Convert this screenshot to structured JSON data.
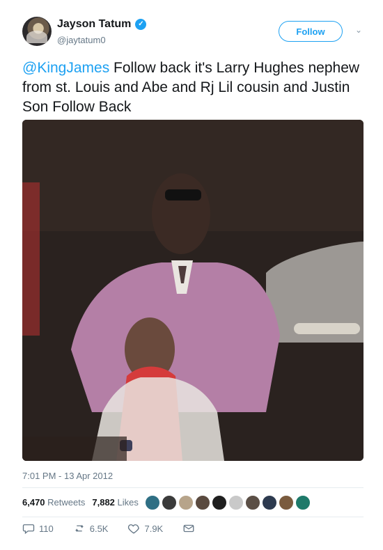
{
  "user": {
    "name": "Jayson Tatum",
    "handle": "@jaytatum0"
  },
  "follow_label": "Follow",
  "tweet": {
    "mention": "@KingJames",
    "text": " Follow back it's Larry Hughes nephew from st. Louis and Abe and Rj Lil cousin and Justin Son Follow Back"
  },
  "timestamp": "7:01 PM - 13 Apr 2012",
  "stats": {
    "retweets_count": "6,470",
    "retweets_label": "Retweets",
    "likes_count": "7,882",
    "likes_label": "Likes"
  },
  "actions": {
    "replies": "110",
    "retweets": "6.5K",
    "likes": "7.9K"
  },
  "likers_colors": [
    "#2f6f84",
    "#3b3b3b",
    "#b7a48a",
    "#5a4a3f",
    "#1f1f1f",
    "#c9c9c9",
    "#5b4f46",
    "#2d3a4f",
    "#7a5b3e",
    "#1e7a6a"
  ],
  "colors": {
    "accent": "#1da1f2",
    "text": "#14171a",
    "muted": "#657786"
  }
}
